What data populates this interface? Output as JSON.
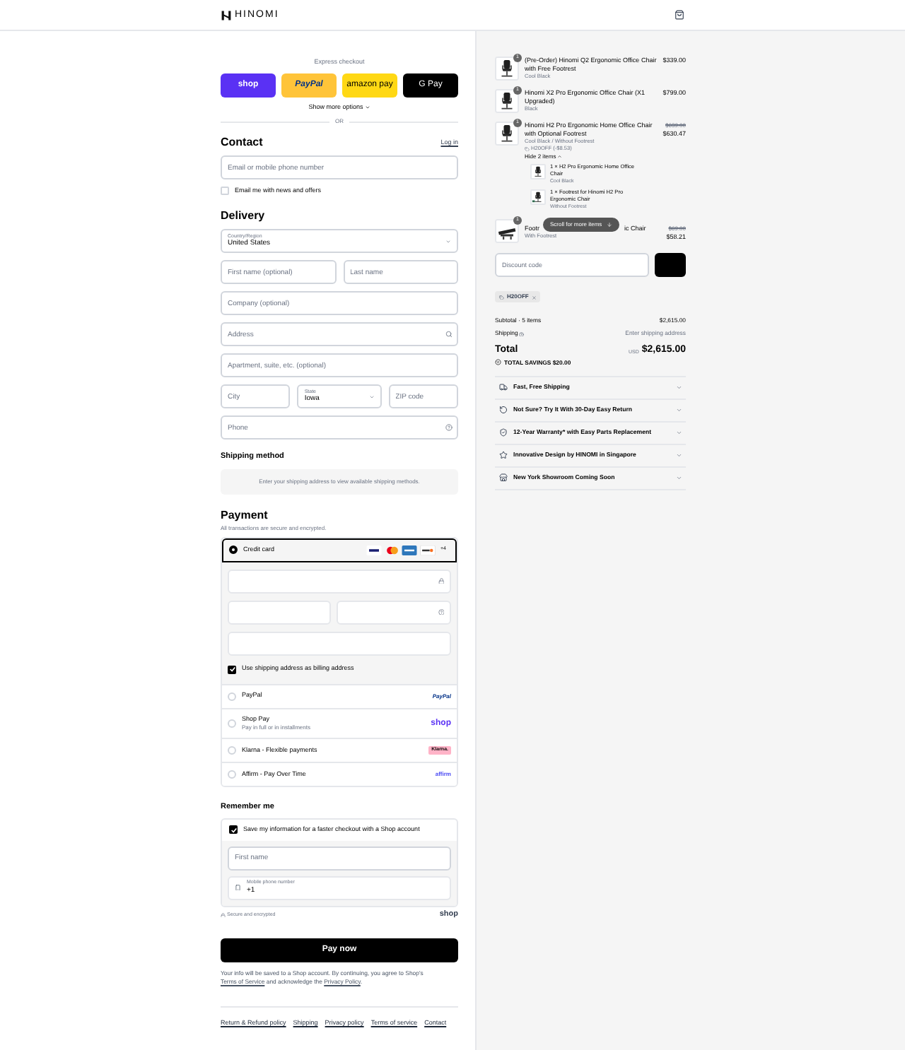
{
  "header": {
    "logo": "HINOMI"
  },
  "express": {
    "label": "Express checkout",
    "buttons": [
      {
        "kind": "shop",
        "label": "shop"
      },
      {
        "kind": "paypal",
        "label": "PayPal"
      },
      {
        "kind": "amazon",
        "label": "amazon pay"
      },
      {
        "kind": "gpay",
        "label": "G Pay"
      }
    ],
    "more": "Show more options",
    "or": "OR"
  },
  "contact": {
    "title": "Contact",
    "login": "Log in",
    "email_placeholder": "Email or mobile phone number",
    "news": {
      "label": "Email me with news and offers",
      "checked": false
    }
  },
  "delivery": {
    "title": "Delivery",
    "rows": [
      [
        {
          "kind": "select",
          "label": "Country/Region",
          "value": "United States"
        }
      ],
      [
        {
          "kind": "text",
          "placeholder": "First name (optional)"
        },
        {
          "kind": "text",
          "placeholder": "Last name"
        }
      ],
      [
        {
          "kind": "text",
          "placeholder": "Company (optional)"
        }
      ],
      [
        {
          "kind": "search",
          "placeholder": "Address"
        }
      ],
      [
        {
          "kind": "text",
          "placeholder": "Apartment, suite, etc. (optional)"
        }
      ],
      [
        {
          "kind": "text",
          "placeholder": "City"
        },
        {
          "kind": "select",
          "label": "State",
          "value": "Iowa"
        },
        {
          "kind": "text",
          "placeholder": "ZIP code"
        }
      ],
      [
        {
          "kind": "help",
          "placeholder": "Phone"
        }
      ]
    ]
  },
  "shipping": {
    "title": "Shipping method",
    "message": "Enter your shipping address to view available shipping methods."
  },
  "payment": {
    "title": "Payment",
    "subtitle": "All transactions are secure and encrypted.",
    "brands": [
      {
        "kind": "visa"
      },
      {
        "kind": "mastercard"
      },
      {
        "kind": "amex"
      },
      {
        "kind": "discover"
      }
    ],
    "more_brands": "+4",
    "billing": {
      "label": "Use shipping address as billing address",
      "checked": true
    },
    "methods": [
      {
        "kind": "card",
        "label": "Credit card",
        "selected": true
      },
      {
        "kind": "paypal",
        "label": "PayPal",
        "logo": "PayPal",
        "selected": false
      },
      {
        "kind": "shop",
        "label": "Shop Pay",
        "sub": "Pay in full or in installments",
        "logo": "shop",
        "selected": false
      },
      {
        "kind": "klarna",
        "label": "Klarna - Flexible payments",
        "logo": "Klarna.",
        "selected": false
      },
      {
        "kind": "affirm",
        "label": "Affirm - Pay Over Time",
        "logo": "affirm",
        "selected": false
      }
    ]
  },
  "remember": {
    "title": "Remember me",
    "save": {
      "label": "Save my information for a faster checkout with a Shop account",
      "checked": true
    },
    "first_name_placeholder": "First name",
    "phone_label": "Mobile phone number",
    "phone_value": "+1",
    "secure": "Secure and encrypted",
    "shop_logo": "shop"
  },
  "pay_button": "Pay now",
  "legal": {
    "before": "Your info will be saved to a Shop account. By continuing, you agree to Shop's",
    "link1": "Terms of Service",
    "middle": "and acknowledge the",
    "link2": "Privacy Policy",
    "end": "."
  },
  "footer_links": [
    "Return & Refund policy",
    "Shipping",
    "Privacy policy",
    "Terms of service",
    "Contact"
  ],
  "summary": {
    "items": [
      {
        "qty": "1",
        "title": "(Pre-Order) Hinomi Q2 Ergonomic Office Chair with Free Footrest",
        "variant": "Cool Black",
        "price": "$339.00"
      },
      {
        "qty": "1",
        "title": "Hinomi X2 Pro Ergonomic Office Chair (X1 Upgraded)",
        "variant": "Black",
        "price": "$799.00"
      },
      {
        "qty": "1",
        "title": "Hinomi H2 Pro Ergonomic Home Office Chair with Optional Footrest",
        "variant": "Cool Black / Without Footrest",
        "discount": "H20OFF (-$8.53)",
        "original": "$639.00",
        "price": "$630.47",
        "toggle": "Hide 2 items",
        "expanded": true,
        "children": [
          {
            "title": "1 × H2 Pro Ergonomic Home Office Chair",
            "variant": "Cool Black"
          },
          {
            "title": "1 × Footrest for Hinomi H2 Pro Ergonomic Chair",
            "variant": "Without Footrest"
          }
        ]
      },
      {
        "qty": "1",
        "title_start": "Footr",
        "title_end": "ic Chair",
        "variant": "With Footrest",
        "original": "$69.00",
        "price": "$58.21"
      }
    ],
    "scroll_hint": "Scroll for more items",
    "discount_placeholder": "Discount code",
    "applied_code": "H20OFF",
    "subtotal_label": "Subtotal · 5 items",
    "subtotal": "$2,615.00",
    "shipping_label": "Shipping",
    "shipping_value": "Enter shipping address",
    "total_label": "Total",
    "currency": "USD",
    "total": "$2,615.00",
    "savings": "TOTAL SAVINGS $20.00",
    "perks": [
      {
        "kind": "truck",
        "label": "Fast, Free Shipping",
        "expanded": false
      },
      {
        "kind": "return",
        "label": "Not Sure? Try It With 30-Day Easy Return",
        "expanded": false
      },
      {
        "kind": "warranty",
        "label": "12-Year Warranty* with Easy Parts Replacement",
        "expanded": false
      },
      {
        "kind": "design",
        "label": "Innovative Design by HINOMI in Singapore",
        "expanded": false
      },
      {
        "kind": "showroom",
        "label": "New York Showroom Coming Soon",
        "expanded": false
      }
    ]
  }
}
